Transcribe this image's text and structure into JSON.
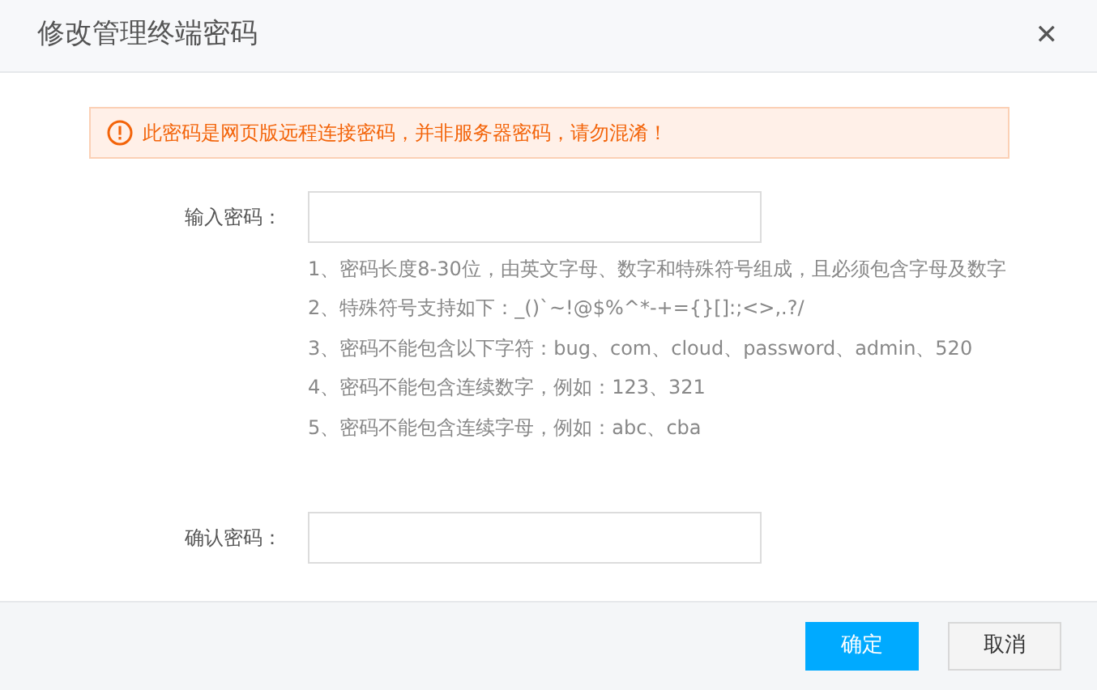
{
  "dialog": {
    "title": "修改管理终端密码",
    "close": "✕"
  },
  "alert": {
    "text": "此密码是网页版远程连接密码，并非服务器密码，请勿混淆！"
  },
  "fields": [
    {
      "label": "输入密码：",
      "rules": [
        "1、密码长度8-30位，由英文字母、数字和特殊符号组成，且必须包含字母及数字",
        "2、特殊符号支持如下：_()`~!@$%^*-+={}[]:;<>,.?/",
        "3、密码不能包含以下字符：bug、com、cloud、password、admin、520",
        "4、密码不能包含连续数字，例如：123、321",
        "5、密码不能包含连续字母，例如：abc、cba"
      ]
    },
    {
      "label": "确认密码："
    }
  ],
  "buttons": [
    {
      "label": "确定",
      "kind": "primary"
    },
    {
      "label": "取消",
      "kind": "secondary"
    }
  ]
}
